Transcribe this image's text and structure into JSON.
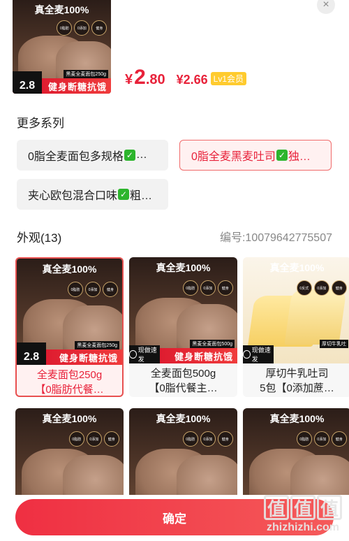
{
  "header": {
    "image_top_text": "真全麦100%",
    "image_banner": "健身断糖抗饿",
    "image_sub_banner": "黑麦全麦面包250g",
    "image_price_tag": "2.8",
    "price_symbol": "¥",
    "price_int": "2",
    "price_dec": ".80",
    "vip_price": "¥2.66",
    "vip_badge": "Lv1会员"
  },
  "close_icon": "×",
  "more_series": {
    "title": "更多系列",
    "items": [
      {
        "label_before": "0脂全麦面包多规格",
        "label_after": "…",
        "selected": false
      },
      {
        "label_before": "0脂全麦黑麦吐司",
        "label_after": "独…",
        "selected": true
      },
      {
        "label_before": "夹心欧包混合口味",
        "label_after": "粗…",
        "selected": false
      }
    ]
  },
  "appearance": {
    "title": "外观(13)",
    "code": "编号:10079642775507",
    "cards": [
      {
        "line1": "全麦面包250g",
        "line2": "【0脂肪代餐…",
        "selected": true,
        "top_text": "真全麦100%",
        "banner": "健身断糖抗饿",
        "sub_banner": "黑麦全麦面包250g",
        "tag": "2.8"
      },
      {
        "line1": "全麦面包500g",
        "line2": "【0脂代餐主…",
        "selected": false,
        "top_text": "真全麦100%",
        "banner": "健身断糖抗饿",
        "sub_banner": "黑麦全麦面包500g",
        "tag": "现做速发"
      },
      {
        "line1": "厚切牛乳吐司",
        "line2": "5包【0添加蔗…",
        "selected": false,
        "top_text": "真全麦100%",
        "banner": "",
        "sub_banner": "厚切牛乳吐",
        "tag": "现做速发"
      },
      {
        "top_text": "真全麦100%"
      },
      {
        "top_text": "真全麦100%"
      },
      {
        "top_text": "真全麦100%"
      }
    ]
  },
  "confirm_label": "确定",
  "watermark": {
    "logo": "值值值",
    "text": "zhizhizhi.com"
  },
  "colors": {
    "accent": "#e8223a",
    "vip_badge": "#ffcb2e",
    "check": "#2db52d"
  }
}
